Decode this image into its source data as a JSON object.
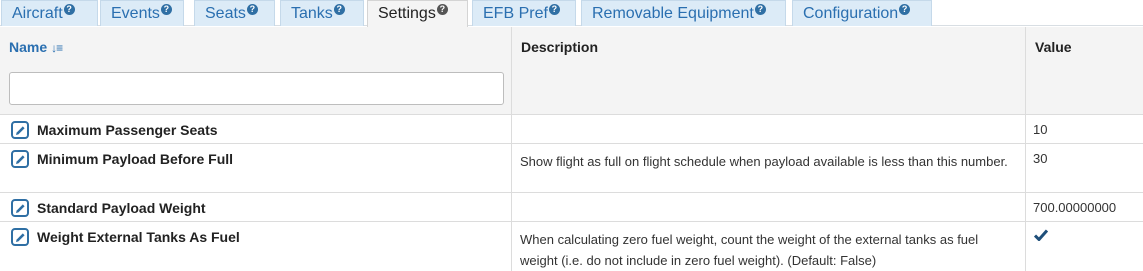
{
  "tabs": [
    {
      "label": "Aircraft",
      "help": "?"
    },
    {
      "label": "Events",
      "help": "?"
    },
    {
      "label": "Seats",
      "help": "?"
    },
    {
      "label": "Tanks",
      "help": "?"
    },
    {
      "label": "Settings",
      "help": "?",
      "active": true
    },
    {
      "label": "EFB Pref",
      "help": "?"
    },
    {
      "label": "Removable Equipment",
      "help": "?"
    },
    {
      "label": "Configuration",
      "help": "?"
    }
  ],
  "grid": {
    "columns": {
      "name": "Name",
      "description": "Description",
      "value": "Value"
    },
    "filter": {
      "value": "",
      "placeholder": ""
    },
    "rows": [
      {
        "name": "Maximum Passenger Seats",
        "description": "",
        "value": "10"
      },
      {
        "name": "Minimum Payload Before Full",
        "description": "Show flight as full on flight schedule when payload available is less than this number.",
        "value": "30"
      },
      {
        "name": "Standard Payload Weight",
        "description": "",
        "value": "700.00000000"
      },
      {
        "name": "Weight External Tanks As Fuel",
        "description": "When calculating zero fuel weight, count the weight of the external tanks as fuel weight (i.e. do not include in zero fuel weight). (Default: False)",
        "value": "true",
        "value_icon": "checkmark-icon"
      }
    ]
  },
  "colors": {
    "tab_bg": "#dcebf7",
    "tab_text": "#2a6fb0",
    "accent": "#2f6fa4",
    "header_bg": "#f4f4f4"
  }
}
